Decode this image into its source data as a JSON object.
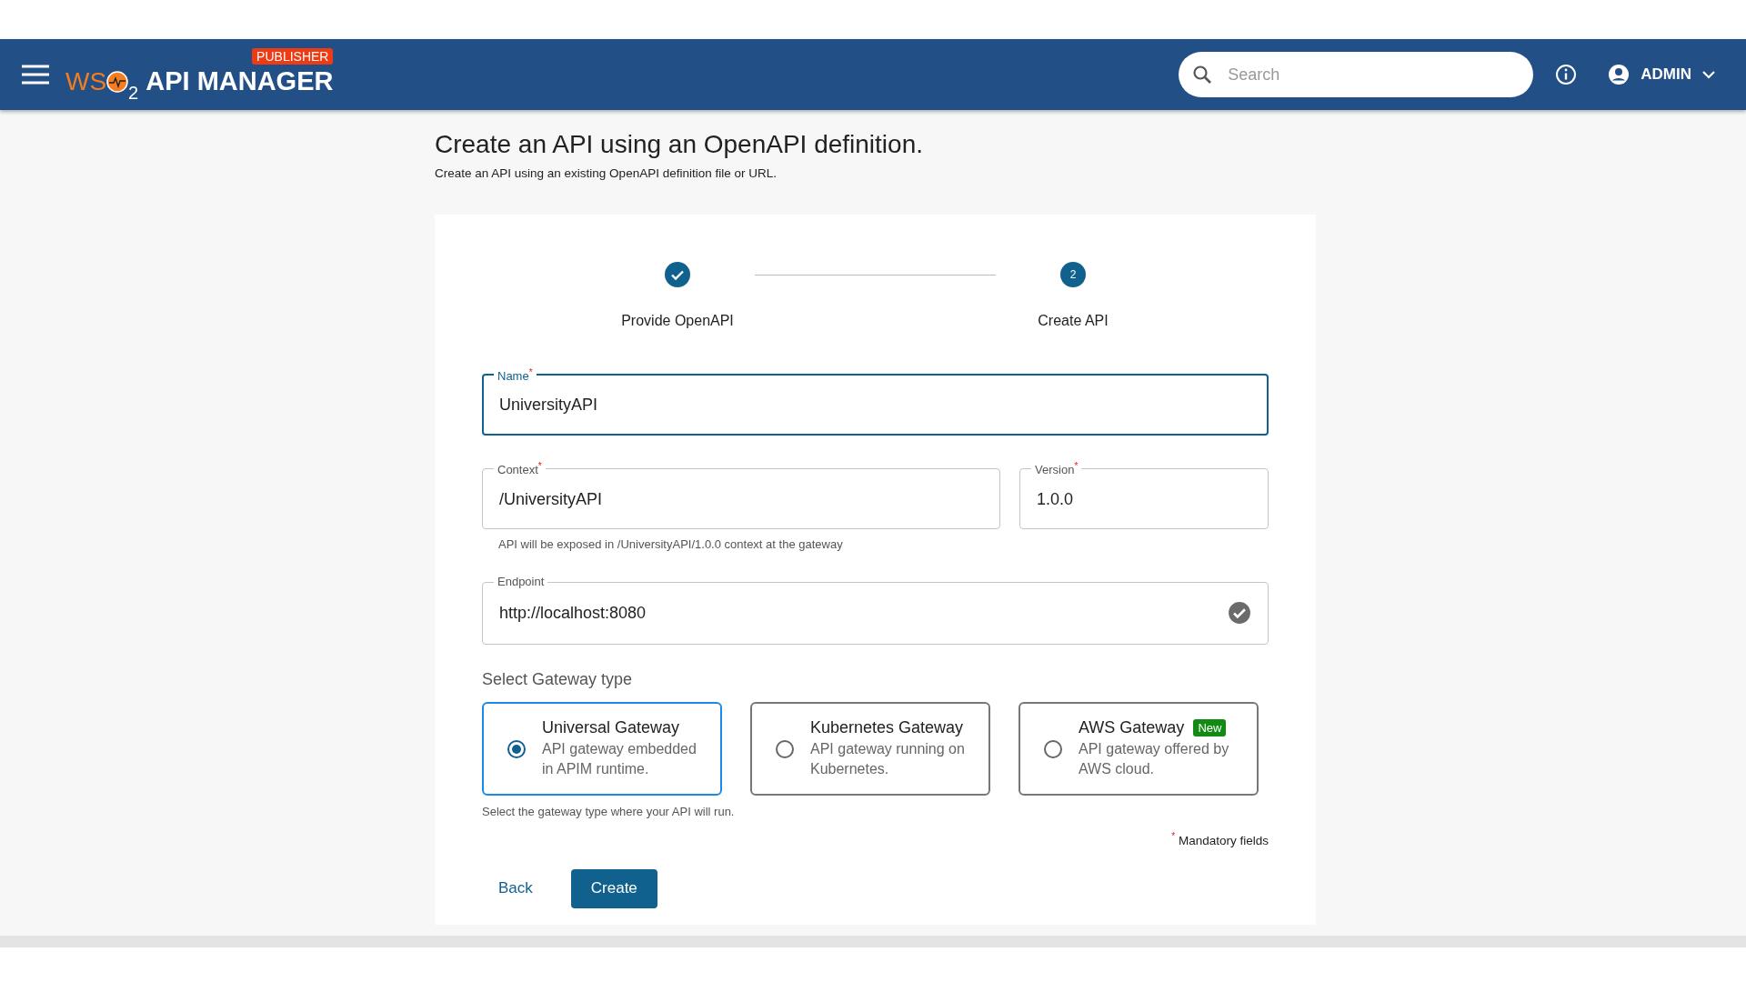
{
  "header": {
    "logo": {
      "prefix": "WS",
      "suffix": "2",
      "product": "API MANAGER",
      "badge": "PUBLISHER"
    },
    "search": {
      "placeholder": "Search"
    },
    "user": "ADMIN"
  },
  "page": {
    "title": "Create an API using an OpenAPI definition.",
    "subtitle": "Create an API using an existing OpenAPI definition file or URL."
  },
  "steps": [
    {
      "label": "Provide OpenAPI",
      "completed": true
    },
    {
      "label": "Create API",
      "number": "2",
      "completed": false
    }
  ],
  "fields": {
    "name": {
      "label": "Name",
      "value": "UniversityAPI",
      "required": true,
      "focused": true
    },
    "context": {
      "label": "Context",
      "value": "/UniversityAPI",
      "required": true,
      "focused": false
    },
    "version": {
      "label": "Version",
      "value": "1.0.0",
      "required": true,
      "focused": false
    },
    "context_helper": "API will be exposed in /UniversityAPI/1.0.0 context at the gateway",
    "endpoint": {
      "label": "Endpoint",
      "value": "http://localhost:8080",
      "required": false,
      "focused": false,
      "valid": true
    }
  },
  "gateway": {
    "title": "Select Gateway type",
    "helper": "Select the gateway type where your API will run.",
    "options": [
      {
        "title": "Universal Gateway",
        "description": "API gateway embedded in APIM runtime.",
        "selected": true
      },
      {
        "title": "Kubernetes Gateway",
        "description": "API gateway running on Kubernetes.",
        "selected": false
      },
      {
        "title": "AWS Gateway",
        "description": "API gateway offered by AWS cloud.",
        "badge": "New",
        "selected": false
      }
    ]
  },
  "required_mark": "*",
  "mandatory_note": "Mandatory fields",
  "buttons": {
    "back": "Back",
    "create": "Create"
  }
}
